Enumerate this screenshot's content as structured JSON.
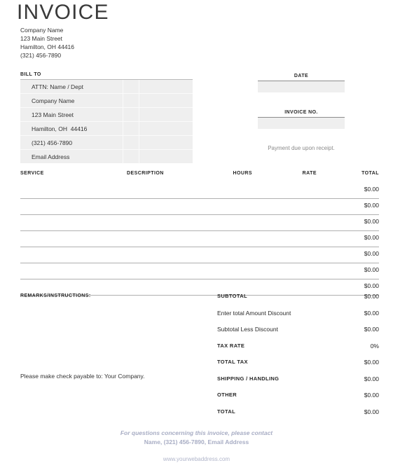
{
  "document": {
    "title": "INVOICE"
  },
  "company": {
    "lines": [
      "Company Name",
      "123 Main Street",
      "Hamilton, OH 44416",
      "(321) 456-7890"
    ]
  },
  "bill_to": {
    "label": "BILL TO",
    "lines": [
      "ATTN: Name / Dept",
      "Company Name",
      "123 Main Street",
      "Hamilton, OH  44416",
      "(321) 456-7890",
      "Email Address"
    ]
  },
  "meta": {
    "date_label": "DATE",
    "date_value": "",
    "date_placeholder": "",
    "invoice_no_label": "INVOICE NO.",
    "invoice_no_value": "",
    "invoice_no_placeholder": "",
    "payment_note": "Payment due upon receipt."
  },
  "services": {
    "headers": {
      "service": "SERVICE",
      "description": "DESCRIPTION",
      "hours": "HOURS",
      "rate": "RATE",
      "total": "TOTAL"
    },
    "rows": [
      {
        "service": "",
        "description": "",
        "hours": "",
        "rate": "",
        "total": "$0.00"
      },
      {
        "service": "",
        "description": "",
        "hours": "",
        "rate": "",
        "total": "$0.00"
      },
      {
        "service": "",
        "description": "",
        "hours": "",
        "rate": "",
        "total": "$0.00"
      },
      {
        "service": "",
        "description": "",
        "hours": "",
        "rate": "",
        "total": "$0.00"
      },
      {
        "service": "",
        "description": "",
        "hours": "",
        "rate": "",
        "total": "$0.00"
      },
      {
        "service": "",
        "description": "",
        "hours": "",
        "rate": "",
        "total": "$0.00"
      },
      {
        "service": "",
        "description": "",
        "hours": "",
        "rate": "",
        "total": "$0.00"
      }
    ]
  },
  "remarks": {
    "label": "REMARKS/INSTRUCTIONS:",
    "value": "",
    "payable_note": "Please make check payable to: Your Company."
  },
  "totals": {
    "rows": [
      {
        "label": "SUBTOTAL",
        "value": "$0.00",
        "style": "caps"
      },
      {
        "label": "Enter total Amount Discount",
        "value": "$0.00",
        "style": "mixed"
      },
      {
        "label": "Subtotal Less Discount",
        "value": "$0.00",
        "style": "mixed"
      },
      {
        "label": "TAX RATE",
        "value": "0%",
        "style": "caps"
      },
      {
        "label": "TOTAL TAX",
        "value": "$0.00",
        "style": "caps"
      },
      {
        "label": "SHIPPING / HANDLING",
        "value": "$0.00",
        "style": "caps"
      },
      {
        "label": "OTHER",
        "value": "$0.00",
        "style": "caps"
      },
      {
        "label": "TOTAL",
        "value": "$0.00",
        "style": "caps"
      }
    ]
  },
  "footer": {
    "line1": "For questions concerning this invoice, please contact",
    "line2": "Name, (321) 456-7890, Email Address",
    "url": "www.yourwebaddress.com"
  },
  "colors": {
    "field_fill": "#efefef",
    "rule": "#b0b0b0",
    "footer_text": "#a8adc4",
    "body_text": "#2b2b2b"
  }
}
